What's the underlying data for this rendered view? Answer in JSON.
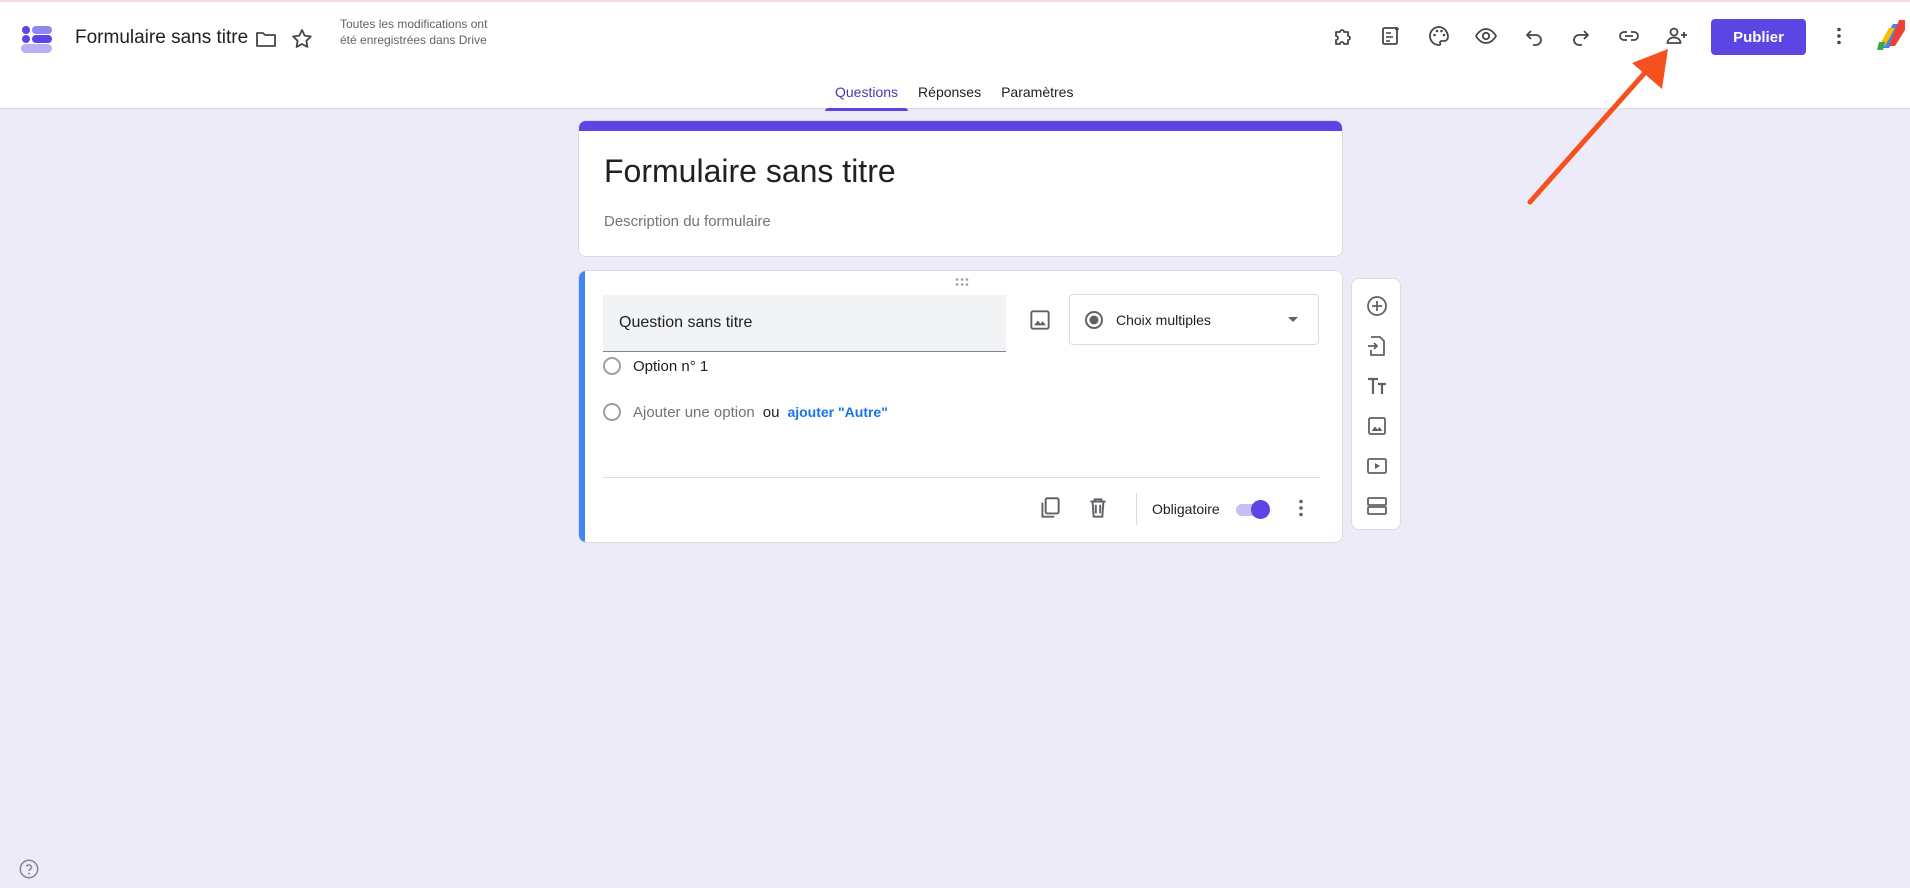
{
  "header": {
    "doc_title": "Formulaire sans titre",
    "save_status": "Toutes les modifications ont été enregistrées dans Drive",
    "publish_label": "Publier",
    "icons": [
      "folder-icon",
      "star-icon",
      "addons-icon",
      "quiz-sheet-icon",
      "palette-icon",
      "preview-eye-icon",
      "undo-icon",
      "redo-icon",
      "link-icon",
      "add-collaborator-icon",
      "more-vert-icon"
    ]
  },
  "tabs": [
    {
      "label": "Questions",
      "active": true
    },
    {
      "label": "Réponses",
      "active": false
    },
    {
      "label": "Paramètres",
      "active": false
    }
  ],
  "form": {
    "title": "Formulaire sans titre",
    "description_placeholder": "Description du formulaire"
  },
  "question": {
    "title": "Question sans titre",
    "type": "Choix multiples",
    "options": [
      "Option n° 1"
    ],
    "add_option": "Ajouter une option",
    "or_text": "ou",
    "add_other": "ajouter \"Autre\"",
    "required_label": "Obligatoire",
    "required": true
  },
  "side_toolbar": [
    "add-question-icon",
    "import-questions-icon",
    "add-title-icon",
    "add-image-icon",
    "add-video-icon",
    "add-section-icon"
  ],
  "colors": {
    "accent": "#5b45e3",
    "question_bar": "#4285f4",
    "background": "#eeebf9",
    "annotation": "#f4511e"
  }
}
